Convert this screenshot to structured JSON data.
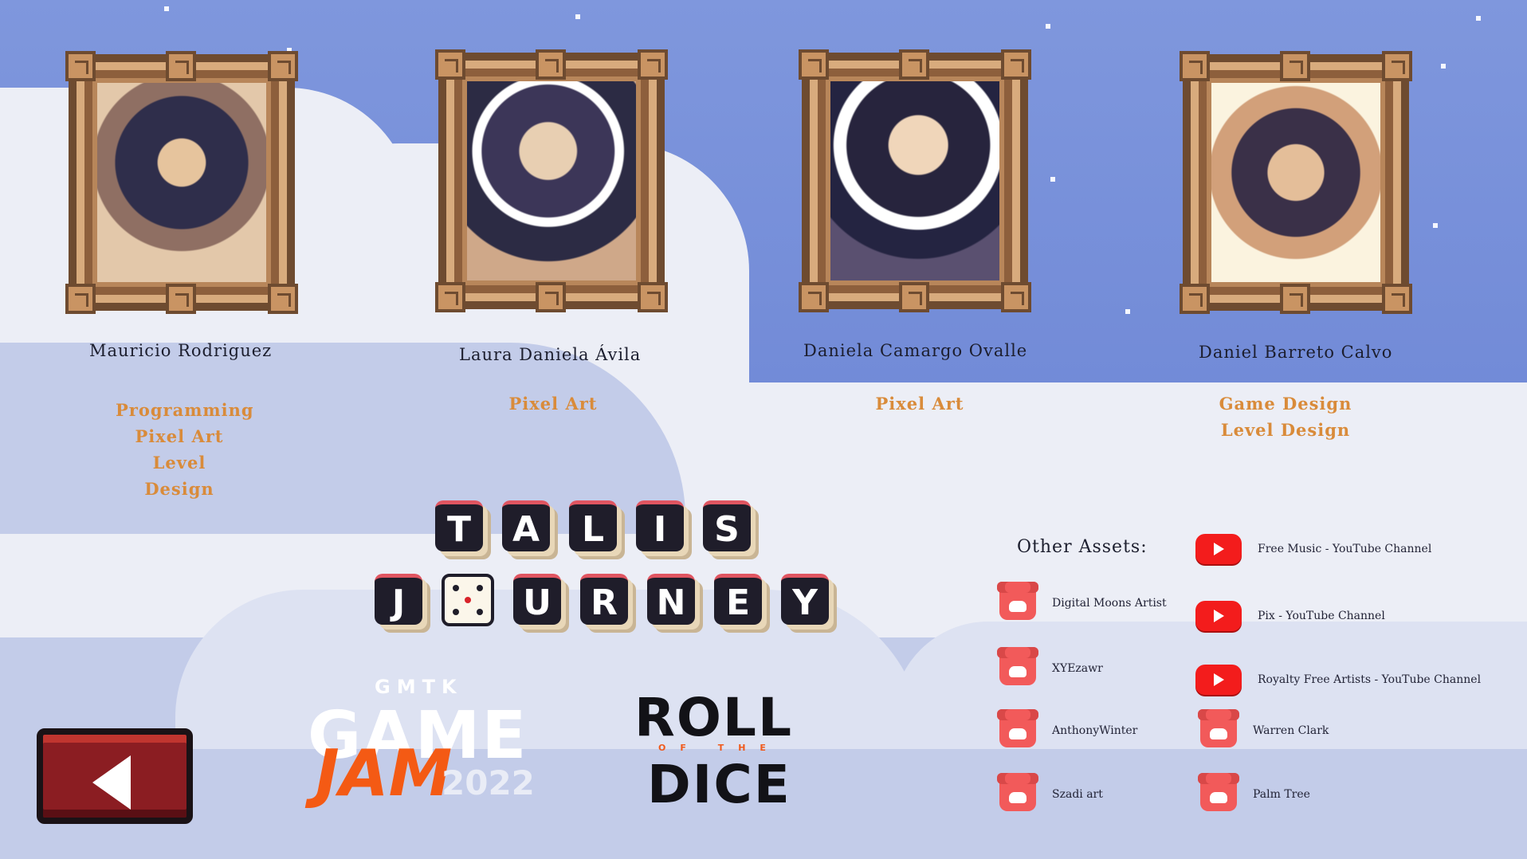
{
  "team": [
    {
      "name": "Mauricio Rodriguez",
      "roles": [
        "Programming",
        "Pixel Art",
        "Level Design"
      ]
    },
    {
      "name": "Laura Daniela Ávila",
      "roles": [
        "Pixel Art"
      ]
    },
    {
      "name": "Daniela Camargo Ovalle",
      "roles": [
        "Pixel Art"
      ]
    },
    {
      "name": "Daniel Barreto Calvo",
      "roles": [
        "Game Design",
        "Level Design"
      ]
    }
  ],
  "game_title": {
    "line1": [
      "T",
      "A",
      "L",
      "I",
      "S"
    ],
    "line2": [
      "J",
      "",
      "U",
      "R",
      "N",
      "E",
      "Y"
    ]
  },
  "gmtk": {
    "top": "GMTK",
    "game": "GAME",
    "jam": "JAM",
    "year": "2022"
  },
  "roll_of_the_dice": {
    "roll": "ROLL",
    "of_the": "OF THE",
    "dice": "DICE"
  },
  "assets": {
    "title": "Other Assets:",
    "youtube": [
      "Free Music - YouTube Channel",
      "Pix - YouTube Channel",
      "Royalty Free Artists - YouTube Channel"
    ],
    "itch_left": [
      "Digital Moons Artist",
      "XYEzawr",
      "AnthonyWinter",
      "Szadi art"
    ],
    "itch_right": [
      "Warren Clark",
      "Palm Tree"
    ]
  },
  "icons": {
    "back": "back-arrow-icon",
    "youtube": "youtube-icon",
    "itch": "itch-io-icon"
  },
  "colors": {
    "role": "#d98b3a",
    "back_button": "#8b1d22",
    "sky": "#7f97dd"
  }
}
